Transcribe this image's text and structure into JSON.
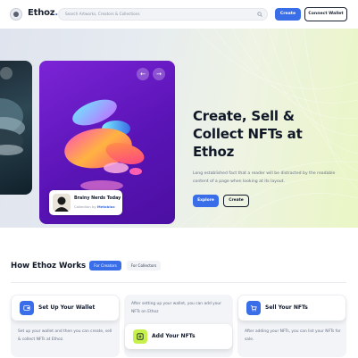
{
  "header": {
    "logo_text": "Ethoz",
    "logo_dot": ".",
    "search_placeholder": "Search Artworks, Creators & Collections",
    "create_label": "Create",
    "connect_wallet_label": "Connect Wallet"
  },
  "hero": {
    "title": "Create, Sell & Collect NFTs at Ethoz",
    "description": "Long established fact that a reader will be distracted by the readable content of a page when looking at its layout.",
    "explore_label": "Explore",
    "create_label": "Create",
    "prev_arrow": "←",
    "next_arrow": "→",
    "featured": {
      "title": "Brainy Nerds Today",
      "collection_prefix": "Collection by",
      "owner": "Metablox"
    }
  },
  "how_it_works": {
    "title": "How Ethoz Works",
    "tabs": [
      {
        "label": "For Creators",
        "active": true
      },
      {
        "label": "For Collectors",
        "active": false
      }
    ],
    "steps": [
      {
        "title": "Set Up Your Wallet",
        "icon": "wallet-icon",
        "description": "Set up your wallet and then you can create, sell & collect NFTs at Ethoz."
      },
      {
        "title": "Add Your NFTs",
        "icon": "add-icon",
        "description": "After setting up your wallet, you can add your NFTs on Ethoz"
      },
      {
        "title": "Sell Your NFTs",
        "icon": "cart-icon",
        "description": "After adding your NFTs, you can list your NFTs for sale."
      }
    ]
  },
  "colors": {
    "accent": "#3a6ee8",
    "lime": "#c6f04a",
    "card_purple": "#6a1cc6"
  }
}
